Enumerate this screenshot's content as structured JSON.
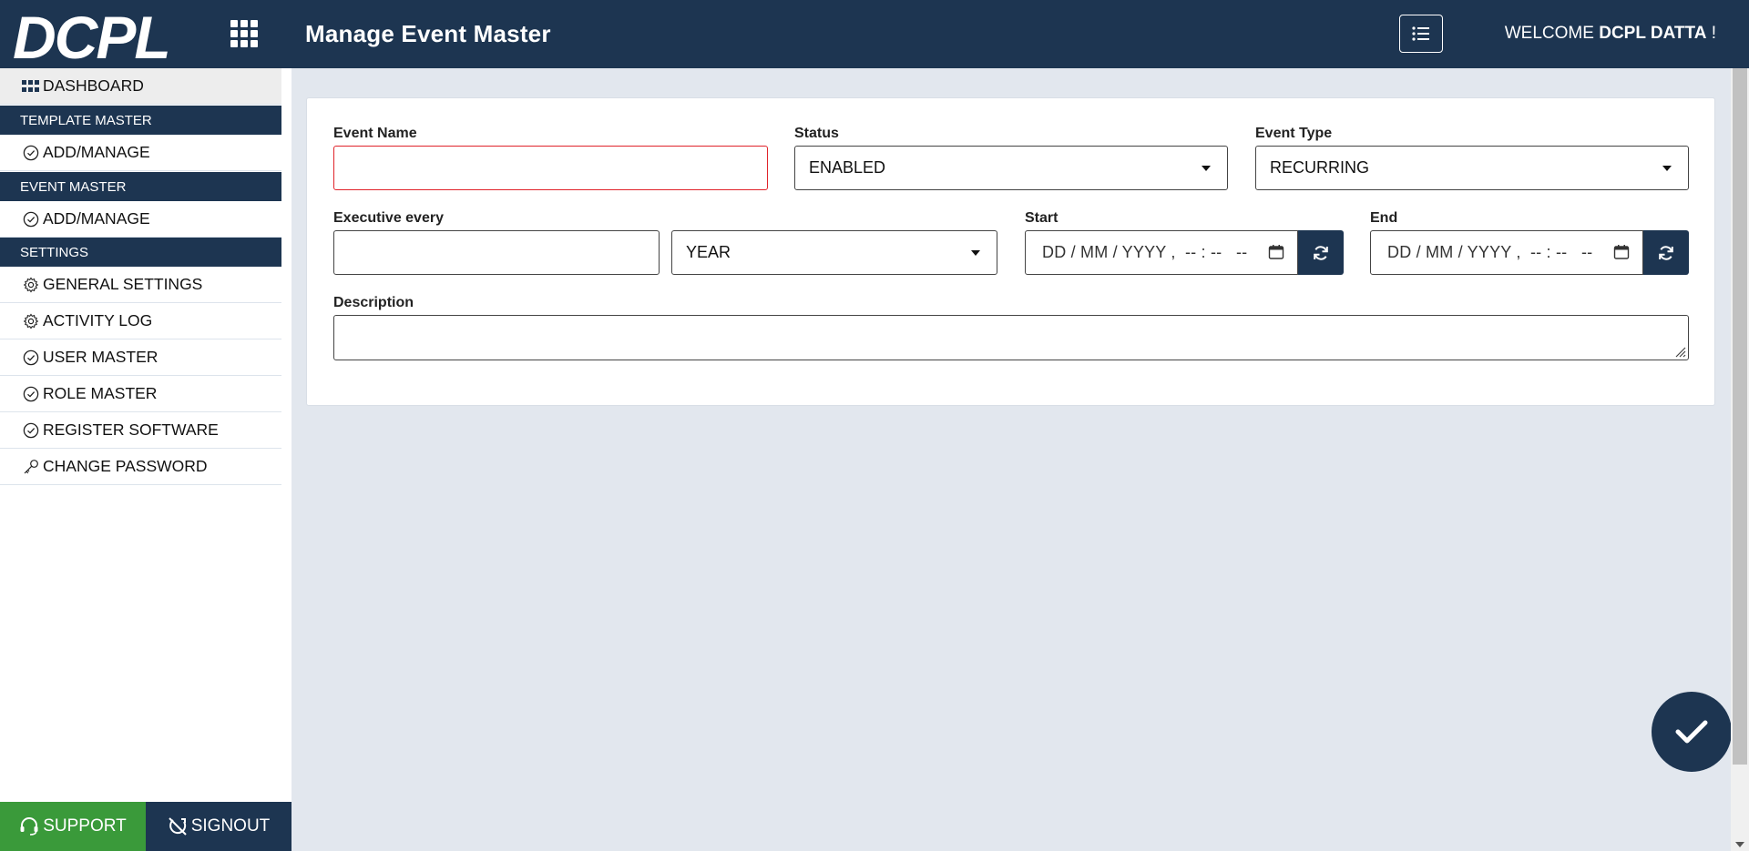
{
  "header": {
    "logo_text": "DCPL",
    "title": "Manage Event Master",
    "welcome_prefix": "WELCOME",
    "user_name": "DCPL DATTA",
    "welcome_suffix": "!",
    "apps_icon": "grid-icon",
    "list_icon": "list-icon"
  },
  "sidebar": {
    "dashboard": "DASHBOARD",
    "sections": [
      {
        "title": "TEMPLATE MASTER",
        "items": [
          {
            "label": "ADD/MANAGE",
            "icon": "check-circle-icon"
          }
        ]
      },
      {
        "title": "EVENT MASTER",
        "items": [
          {
            "label": "ADD/MANAGE",
            "icon": "check-circle-icon"
          }
        ]
      },
      {
        "title": "SETTINGS",
        "items": [
          {
            "label": "GENERAL SETTINGS",
            "icon": "gear-icon"
          },
          {
            "label": "ACTIVITY LOG",
            "icon": "gear-icon"
          },
          {
            "label": "USER MASTER",
            "icon": "check-circle-icon"
          },
          {
            "label": "ROLE MASTER",
            "icon": "check-circle-icon"
          },
          {
            "label": "REGISTER SOFTWARE",
            "icon": "check-circle-icon"
          },
          {
            "label": "CHANGE PASSWORD",
            "icon": "key-icon"
          }
        ]
      }
    ],
    "support_label": "SUPPORT",
    "signout_label": "SIGNOUT"
  },
  "form": {
    "event_name_label": "Event Name",
    "event_name_value": "",
    "status_label": "Status",
    "status_value": "ENABLED",
    "event_type_label": "Event Type",
    "event_type_value": "RECURRING",
    "executive_every_label": "Executive every",
    "executive_every_value": "",
    "period_value": "YEAR",
    "start_label": "Start",
    "start_placeholder": "DD / MM / YYYY ,  -- : --   --",
    "end_label": "End",
    "end_placeholder": "DD / MM / YYYY ,  -- : --   --",
    "description_label": "Description",
    "description_value": ""
  },
  "colors": {
    "primary": "#1d3551",
    "support": "#3a9a3a",
    "error": "#e0232a"
  }
}
